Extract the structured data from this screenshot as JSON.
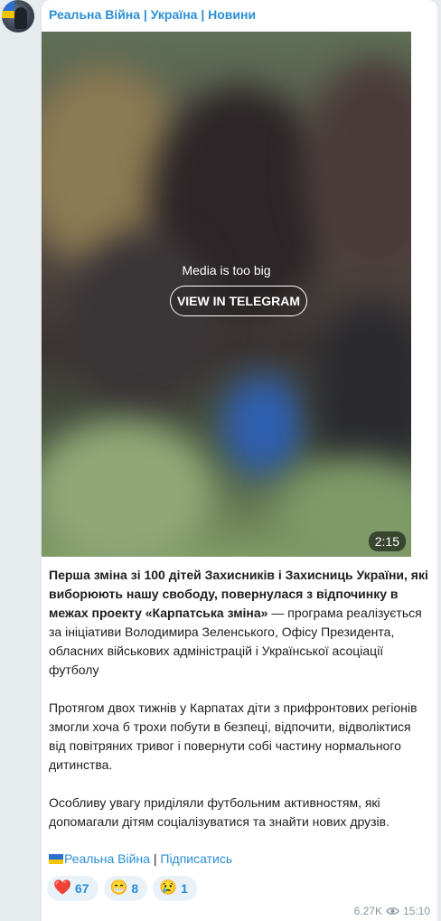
{
  "channel": {
    "name": "Реальна Війна | Україна | Новини"
  },
  "media": {
    "message": "Media is too big",
    "button_label": "VIEW IN TELEGRAM",
    "duration": "2:15"
  },
  "post": {
    "p1_bold": "Перша зміна зі 100 дітей Захисників і Захисниць України, які виборюють нашу свободу, повернулася з відпочинку в межах проекту «Карпатська зміна»",
    "p1_rest": " — програма реалізується за ініціативи Володимира Зеленського, Офісу Президента, обласних військових адміністрацій і Української асоціації футболу",
    "p2": "Протягом двох тижнів у Карпатах діти з прифронтових регіонів змогли хоча б трохи побути в безпеці, відпочити, відволіктися від повітряних тривог і повернути собі частину нормального дитинства.",
    "p3": "Особливу увагу приділяли футбольним активностям, які допомагали дітям соціалізуватися та знайти нових друзів."
  },
  "footer": {
    "channel_link": "Реальна Війна",
    "separator": " | ",
    "subscribe_link": "Підписатись",
    "flag_icon": "ukraine-flag-icon"
  },
  "reactions": [
    {
      "emoji": "❤️",
      "icon": "heart-icon",
      "count": "67"
    },
    {
      "emoji": "😁",
      "icon": "grin-icon",
      "count": "8"
    },
    {
      "emoji": "😢",
      "icon": "cry-icon",
      "count": "1"
    }
  ],
  "meta": {
    "views": "6.27K",
    "time": "15:10",
    "views_icon": "eye-icon"
  },
  "colors": {
    "accent": "#2b8fd6",
    "background": "#e6ebee",
    "bubble": "#ffffff"
  }
}
